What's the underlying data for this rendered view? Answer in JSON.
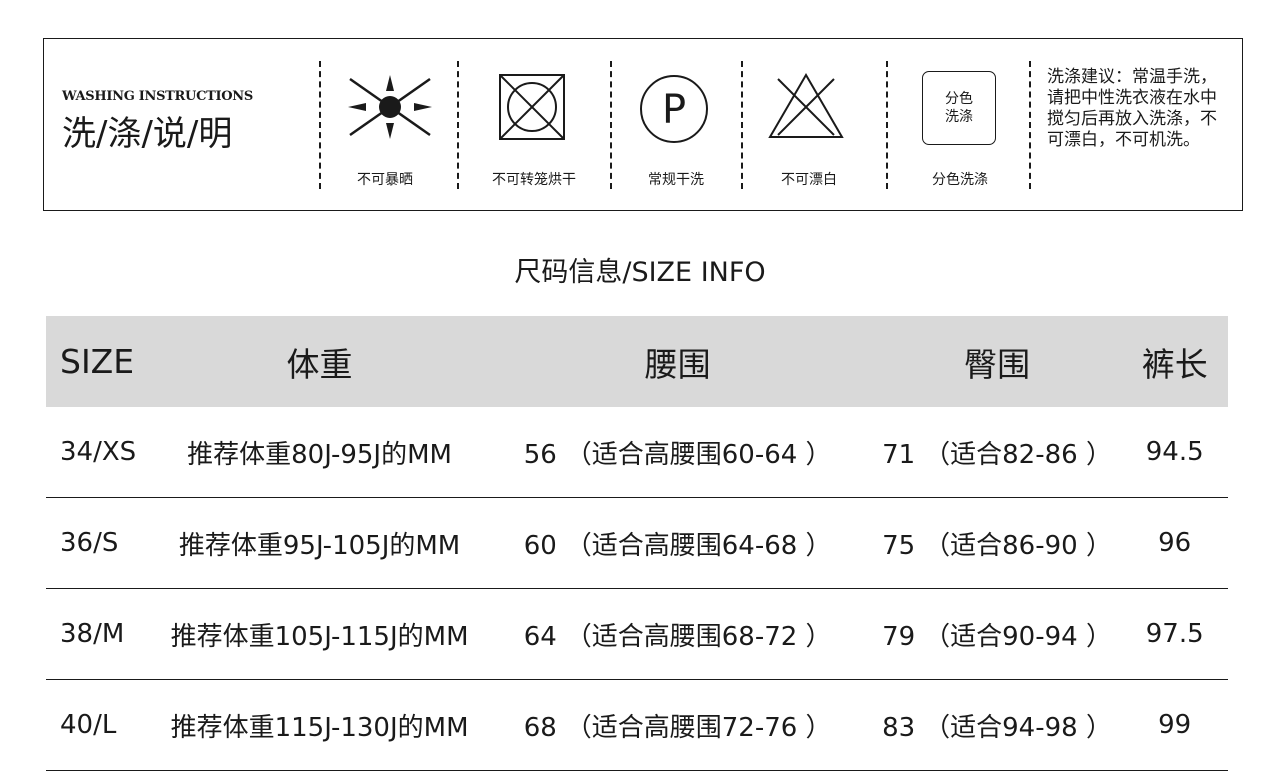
{
  "washing": {
    "title_en": "WASHING INSTRUCTIONS",
    "title_cn": "洗/涤/说/明",
    "symbols": [
      {
        "icon": "no-sun-drying-icon",
        "label": "不可暴晒"
      },
      {
        "icon": "no-tumble-dry-icon",
        "label": "不可转笼烘干"
      },
      {
        "icon": "dry-clean-p-icon",
        "symbol_text": "P",
        "label": "常规干洗"
      },
      {
        "icon": "no-bleach-icon",
        "label": "不可漂白"
      },
      {
        "icon": "wash-separately-icon",
        "box_line1": "分色",
        "box_line2": "洗涤",
        "label": "分色洗涤"
      }
    ],
    "advice": "洗涤建议：常温手洗，请把中性洗衣液在水中搅匀后再放入洗涤，不可漂白，不可机洗。"
  },
  "size_info": {
    "title": "尺码信息/SIZE INFO",
    "headers": [
      "SIZE",
      "体重",
      "腰围",
      "臀围",
      "裤长"
    ],
    "rows": [
      {
        "size": "34/XS",
        "weight": "推荐体重80J-95J的MM",
        "waist": "56",
        "waist_note": "（适合高腰围60-64 ）",
        "hip": "71",
        "hip_note": "（适合82-86 ）",
        "length": "94.5"
      },
      {
        "size": "36/S",
        "weight": "推荐体重95J-105J的MM",
        "waist": "60",
        "waist_note": "（适合高腰围64-68 ）",
        "hip": "75",
        "hip_note": "（适合86-90 ）",
        "length": "96"
      },
      {
        "size": "38/M",
        "weight": "推荐体重105J-115J的MM",
        "waist": "64",
        "waist_note": "（适合高腰围68-72 ）",
        "hip": "79",
        "hip_note": "（适合90-94 ）",
        "length": "97.5"
      },
      {
        "size": "40/L",
        "weight": "推荐体重115J-130J的MM",
        "waist": "68",
        "waist_note": "（适合高腰围72-76 ）",
        "hip": "83",
        "hip_note": "（适合94-98 ）",
        "length": "99"
      }
    ]
  }
}
